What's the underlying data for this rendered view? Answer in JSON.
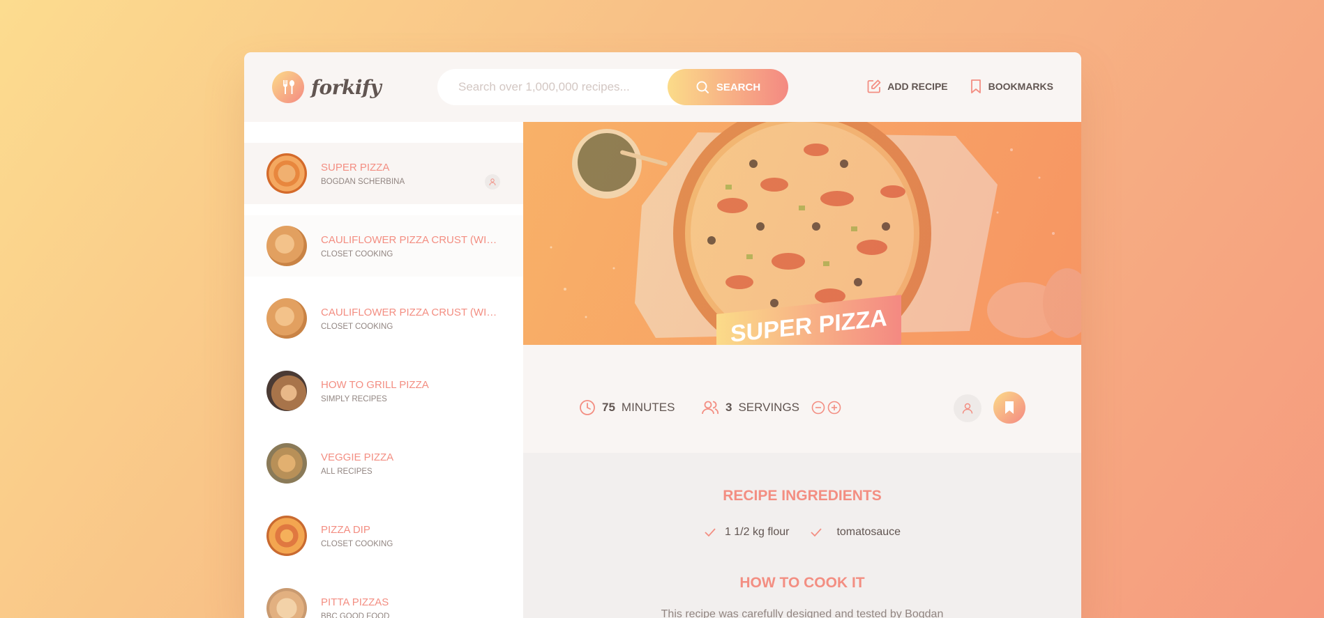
{
  "header": {
    "logo_text": "forkify",
    "search_placeholder": "Search over 1,000,000 recipes...",
    "search_button": "SEARCH",
    "nav": {
      "add_recipe": "ADD RECIPE",
      "bookmarks": "BOOKMARKS"
    }
  },
  "results": [
    {
      "title": "SUPER PIZZA",
      "publisher": "BOGDAN SCHERBINA"
    },
    {
      "title": "CAULIFLOWER PIZZA CRUST (WITH BBQ CHICKEN PIZZA)",
      "publisher": "CLOSET COOKING"
    },
    {
      "title": "CAULIFLOWER PIZZA CRUST (WITH CHICKEN PIZZA)",
      "publisher": "CLOSET COOKING"
    },
    {
      "title": "HOW TO GRILL PIZZA",
      "publisher": "SIMPLY RECIPES"
    },
    {
      "title": "VEGGIE PIZZA",
      "publisher": "ALL RECIPES"
    },
    {
      "title": "PIZZA DIP",
      "publisher": "CLOSET COOKING"
    },
    {
      "title": "PITTA PIZZAS",
      "publisher": "BBC GOOD FOOD"
    }
  ],
  "recipe": {
    "title": "SUPER PIZZA",
    "cooking_time": "75",
    "cooking_unit": "MINUTES",
    "servings": "3",
    "servings_unit": "SERVINGS",
    "ingredients_heading": "RECIPE INGREDIENTS",
    "ingredients": [
      "1 1/2 kg flour",
      "tomatosauce"
    ],
    "how_to_heading": "HOW TO COOK IT",
    "how_to_text": "This recipe was carefully designed and tested by Bogdan"
  },
  "colors": {
    "accent": "#f38e82",
    "gradient_start": "#fbdb89",
    "gradient_end": "#f48982"
  }
}
